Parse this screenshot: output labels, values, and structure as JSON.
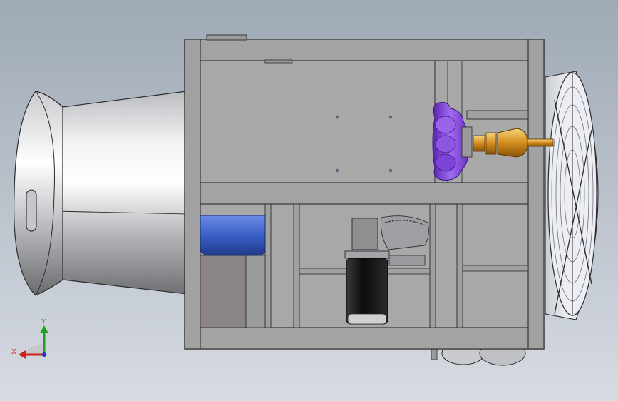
{
  "viewport": {
    "background_top": "#9ea9b6",
    "background_bottom": "#d7dbe2"
  },
  "colors": {
    "frame": "#a8a8a8",
    "frame_dark": "#8b8b8b",
    "outline": "#2b2b2b",
    "nozzle_light": "#ffffff",
    "nozzle_mid": "#d4d6d9",
    "nozzle_dark": "#7e8084",
    "blue_tank": "#3b62c8",
    "purple_pump": "#8a4de0",
    "brass": "#d89a28",
    "motor_black": "#121212",
    "fan_grille": "#e8e8ee",
    "axis_x": "#d02020",
    "axis_y": "#20a020",
    "axis_z": "#2030c0"
  },
  "triad": {
    "x_label": "X",
    "y_label": "Y"
  }
}
